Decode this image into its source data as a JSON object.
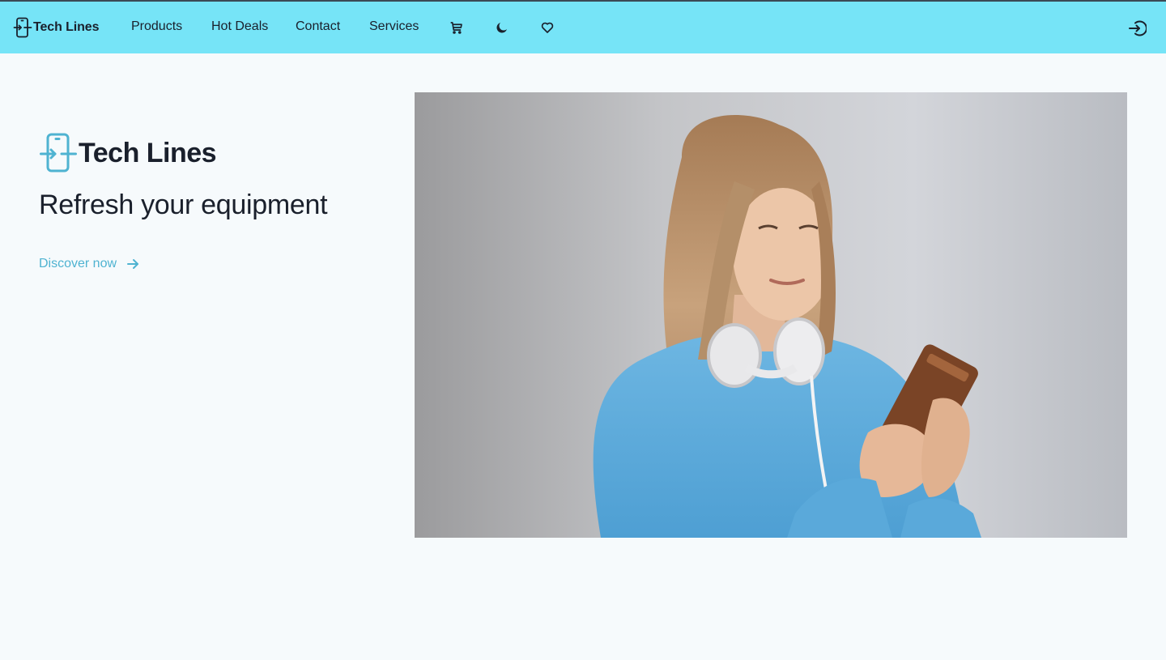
{
  "nav": {
    "brand": "Tech Lines",
    "links": [
      "Products",
      "Hot Deals",
      "Contact",
      "Services"
    ],
    "icons": [
      "cart-icon",
      "moon-icon",
      "heart-icon",
      "login-icon"
    ],
    "background": "#76e4f7"
  },
  "hero": {
    "title": "Tech Lines",
    "subtitle": "Refresh your equipment",
    "cta_label": "Discover now",
    "accent": "#4fb3d1",
    "image_alt_icon": "woman-with-phone-photo"
  }
}
